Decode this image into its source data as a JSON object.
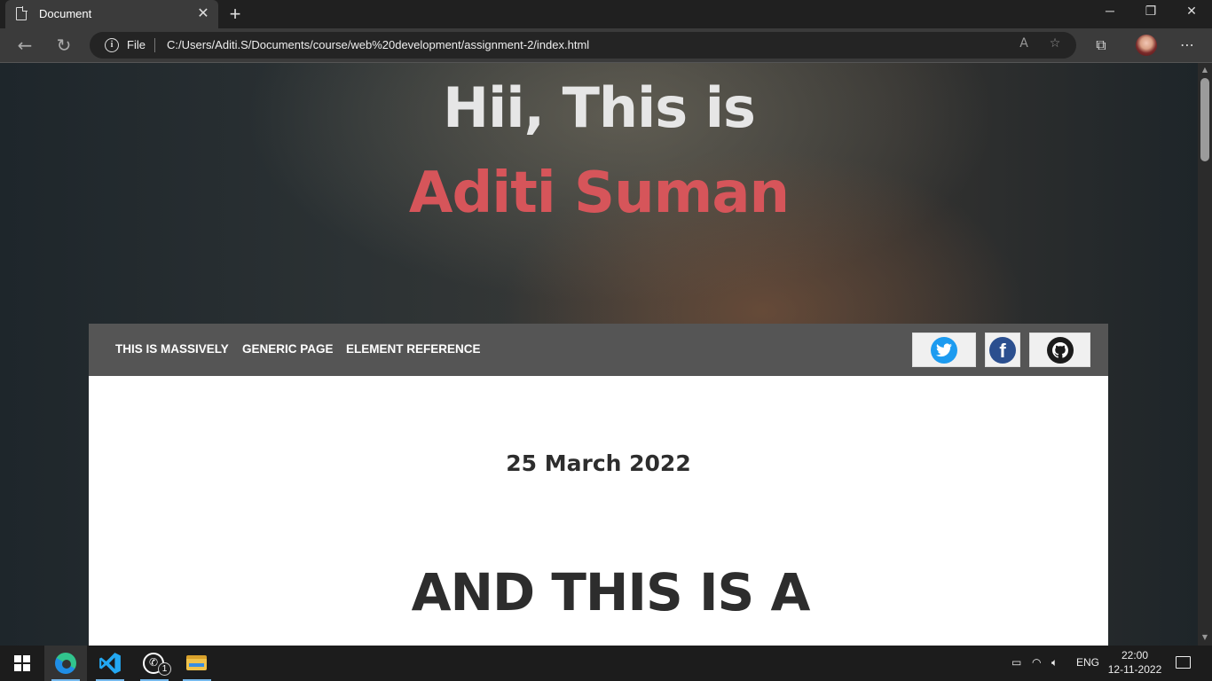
{
  "browser": {
    "tab_title": "Document",
    "address_scheme": "File",
    "address_url": "C:/Users/Aditi.S/Documents/course/web%20development/assignment-2/index.html"
  },
  "page": {
    "hero_line1": "Hii, This is",
    "hero_line2": "Aditi Suman",
    "nav": [
      "THIS IS MASSIVELY",
      "GENERIC PAGE",
      "ELEMENT REFERENCE"
    ],
    "date": "25 March 2022",
    "headline": "AND THIS IS A",
    "colors": {
      "accent": "#d6555a",
      "nav_bg": "#555555",
      "panel_bg": "#ffffff"
    }
  },
  "taskbar": {
    "whatsapp_badge": "1",
    "language": "ENG",
    "time": "22:00",
    "date": "12-11-2022"
  },
  "icons": {
    "twitter": "twitter-icon",
    "facebook": "facebook-icon",
    "github": "github-icon"
  }
}
